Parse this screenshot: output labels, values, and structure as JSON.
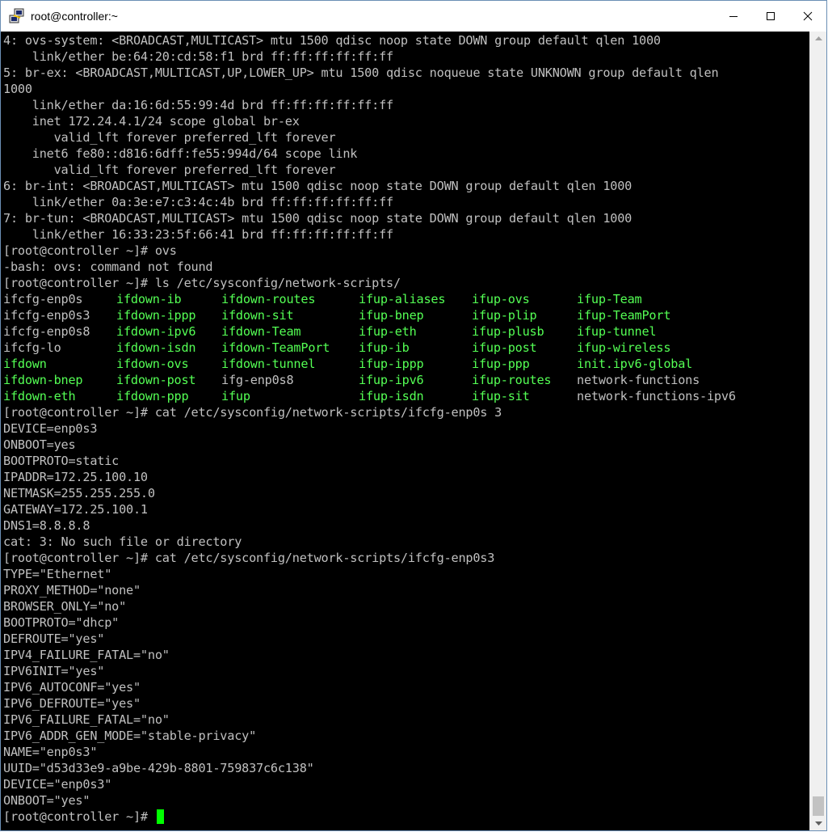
{
  "window": {
    "title": "root@controller:~",
    "app_icon": "putty-icon",
    "controls": [
      "minimize-icon",
      "maximize-icon",
      "close-icon"
    ]
  },
  "terminal": {
    "colors": {
      "background": "#000000",
      "text": "#c0c0c0",
      "executable": "#54ff54",
      "cursor": "#00ff00"
    },
    "lines_before": [
      "4: ovs-system: <BROADCAST,MULTICAST> mtu 1500 qdisc noop state DOWN group default qlen 1000",
      "    link/ether be:64:20:cd:58:f1 brd ff:ff:ff:ff:ff:ff",
      "5: br-ex: <BROADCAST,MULTICAST,UP,LOWER_UP> mtu 1500 qdisc noqueue state UNKNOWN group default qlen",
      "1000",
      "    link/ether da:16:6d:55:99:4d brd ff:ff:ff:ff:ff:ff",
      "    inet 172.24.4.1/24 scope global br-ex",
      "       valid_lft forever preferred_lft forever",
      "    inet6 fe80::d816:6dff:fe55:994d/64 scope link",
      "       valid_lft forever preferred_lft forever",
      "6: br-int: <BROADCAST,MULTICAST> mtu 1500 qdisc noop state DOWN group default qlen 1000",
      "    link/ether 0a:3e:e7:c3:4c:4b brd ff:ff:ff:ff:ff:ff",
      "7: br-tun: <BROADCAST,MULTICAST> mtu 1500 qdisc noop state DOWN group default qlen 1000",
      "    link/ether 16:33:23:5f:66:41 brd ff:ff:ff:ff:ff:ff",
      "[root@controller ~]# ovs",
      "-bash: ovs: command not found",
      "[root@controller ~]# ls /etc/sysconfig/network-scripts/"
    ],
    "ls_grid": [
      [
        {
          "t": "ifcfg-enp0s",
          "g": false
        },
        {
          "t": "ifdown-ib",
          "g": true
        },
        {
          "t": "ifdown-routes",
          "g": true
        },
        {
          "t": "ifup-aliases",
          "g": true
        },
        {
          "t": "ifup-ovs",
          "g": true
        },
        {
          "t": "ifup-Team",
          "g": true
        }
      ],
      [
        {
          "t": "ifcfg-enp0s3",
          "g": false
        },
        {
          "t": "ifdown-ippp",
          "g": true
        },
        {
          "t": "ifdown-sit",
          "g": true
        },
        {
          "t": "ifup-bnep",
          "g": true
        },
        {
          "t": "ifup-plip",
          "g": true
        },
        {
          "t": "ifup-TeamPort",
          "g": true
        }
      ],
      [
        {
          "t": "ifcfg-enp0s8",
          "g": false
        },
        {
          "t": "ifdown-ipv6",
          "g": true
        },
        {
          "t": "ifdown-Team",
          "g": true
        },
        {
          "t": "ifup-eth",
          "g": true
        },
        {
          "t": "ifup-plusb",
          "g": true
        },
        {
          "t": "ifup-tunnel",
          "g": true
        }
      ],
      [
        {
          "t": "ifcfg-lo",
          "g": false
        },
        {
          "t": "ifdown-isdn",
          "g": true
        },
        {
          "t": "ifdown-TeamPort",
          "g": true
        },
        {
          "t": "ifup-ib",
          "g": true
        },
        {
          "t": "ifup-post",
          "g": true
        },
        {
          "t": "ifup-wireless",
          "g": true
        }
      ],
      [
        {
          "t": "ifdown",
          "g": true
        },
        {
          "t": "ifdown-ovs",
          "g": true
        },
        {
          "t": "ifdown-tunnel",
          "g": true
        },
        {
          "t": "ifup-ippp",
          "g": true
        },
        {
          "t": "ifup-ppp",
          "g": true
        },
        {
          "t": "init.ipv6-global",
          "g": true
        }
      ],
      [
        {
          "t": "ifdown-bnep",
          "g": true
        },
        {
          "t": "ifdown-post",
          "g": true
        },
        {
          "t": "ifg-enp0s8",
          "g": false
        },
        {
          "t": "ifup-ipv6",
          "g": true
        },
        {
          "t": "ifup-routes",
          "g": true
        },
        {
          "t": "network-functions",
          "g": false
        }
      ],
      [
        {
          "t": "ifdown-eth",
          "g": true
        },
        {
          "t": "ifdown-ppp",
          "g": true
        },
        {
          "t": "ifup",
          "g": true
        },
        {
          "t": "ifup-isdn",
          "g": true
        },
        {
          "t": "ifup-sit",
          "g": true
        },
        {
          "t": "network-functions-ipv6",
          "g": false
        }
      ]
    ],
    "lines_after": [
      "[root@controller ~]# cat /etc/sysconfig/network-scripts/ifcfg-enp0s 3",
      "DEVICE=enp0s3",
      "ONBOOT=yes",
      "BOOTPROTO=static",
      "IPADDR=172.25.100.10",
      "NETMASK=255.255.255.0",
      "GATEWAY=172.25.100.1",
      "DNS1=8.8.8.8",
      "cat: 3: No such file or directory",
      "[root@controller ~]# cat /etc/sysconfig/network-scripts/ifcfg-enp0s3",
      "TYPE=\"Ethernet\"",
      "PROXY_METHOD=\"none\"",
      "BROWSER_ONLY=\"no\"",
      "BOOTPROTO=\"dhcp\"",
      "DEFROUTE=\"yes\"",
      "IPV4_FAILURE_FATAL=\"no\"",
      "IPV6INIT=\"yes\"",
      "IPV6_AUTOCONF=\"yes\"",
      "IPV6_DEFROUTE=\"yes\"",
      "IPV6_FAILURE_FATAL=\"no\"",
      "IPV6_ADDR_GEN_MODE=\"stable-privacy\"",
      "NAME=\"enp0s3\"",
      "UUID=\"d53d33e9-a9be-429b-8801-759837c6c138\"",
      "DEVICE=\"enp0s3\"",
      "ONBOOT=\"yes\""
    ],
    "prompt": "[root@controller ~]# "
  }
}
